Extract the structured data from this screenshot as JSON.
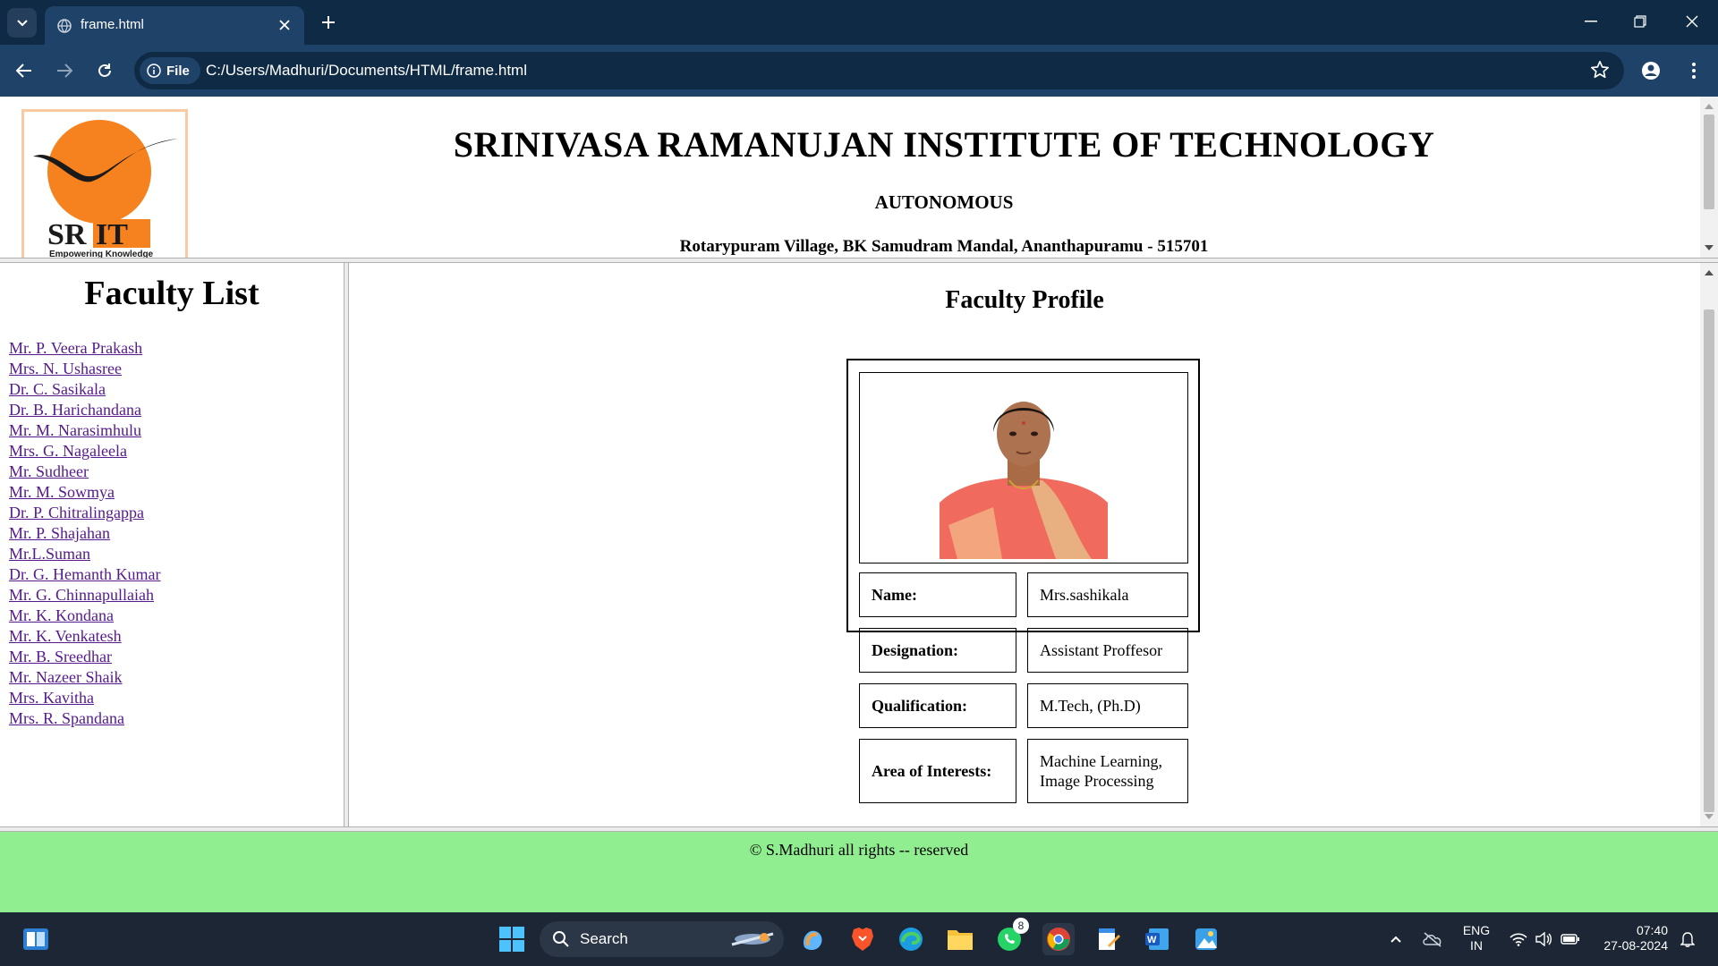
{
  "browser": {
    "tab_title": "frame.html",
    "site_chip": "File",
    "url": "C:/Users/Madhuri/Documents/HTML/frame.html"
  },
  "header": {
    "logo_text": "SRIT",
    "logo_tagline": "Empowering Knowledge",
    "title": "SRINIVASA RAMANUJAN INSTITUTE OF TECHNOLOGY",
    "subtitle": "AUTONOMOUS",
    "address": "Rotarypuram Village, BK Samudram Mandal, Ananthapuramu - 515701"
  },
  "faculty_list": {
    "title": "Faculty List",
    "items": [
      "Mr. P. Veera Prakash",
      "Mrs. N. Ushasree",
      "Dr. C. Sasikala",
      "Dr. B. Harichandana",
      "Mr. M. Narasimhulu",
      "Mrs. G. Nagaleela",
      "Mr. Sudheer",
      "Mr. M. Sowmya",
      "Dr. P. Chitralingappa",
      "Mr. P. Shajahan",
      "Mr.L.Suman",
      "Dr. G. Hemanth Kumar",
      "Mr. G. Chinnapullaiah",
      "Mr. K. Kondana",
      "Mr. K. Venkatesh",
      "Mr. B. Sreedhar",
      "Mr. Nazeer Shaik",
      "Mrs. Kavitha",
      "Mrs. R. Spandana"
    ]
  },
  "profile": {
    "title": "Faculty Profile",
    "rows": [
      {
        "label": "Name:",
        "value": "Mrs.sashikala"
      },
      {
        "label": "Designation:",
        "value": "Assistant Proffesor"
      },
      {
        "label": "Qualification:",
        "value": "M.Tech, (Ph.D)"
      },
      {
        "label": "Area of Interests:",
        "value": "Machine Learning, Image Processing"
      }
    ]
  },
  "footer": {
    "text": "© S.Madhuri all rights -- reserved"
  },
  "taskbar": {
    "search_label": "Search",
    "whatsapp_badge": "8",
    "lang_line1": "ENG",
    "lang_line2": "IN",
    "time": "07:40",
    "date": "27-08-2024"
  },
  "colors": {
    "tabbar_bg": "#0f2a44",
    "toolbar_bg": "#1f4268",
    "link": "#551a8b",
    "footer_bg": "#90ee90",
    "logo_orange": "#f5821f",
    "taskbar_bg": "#1c2634"
  }
}
